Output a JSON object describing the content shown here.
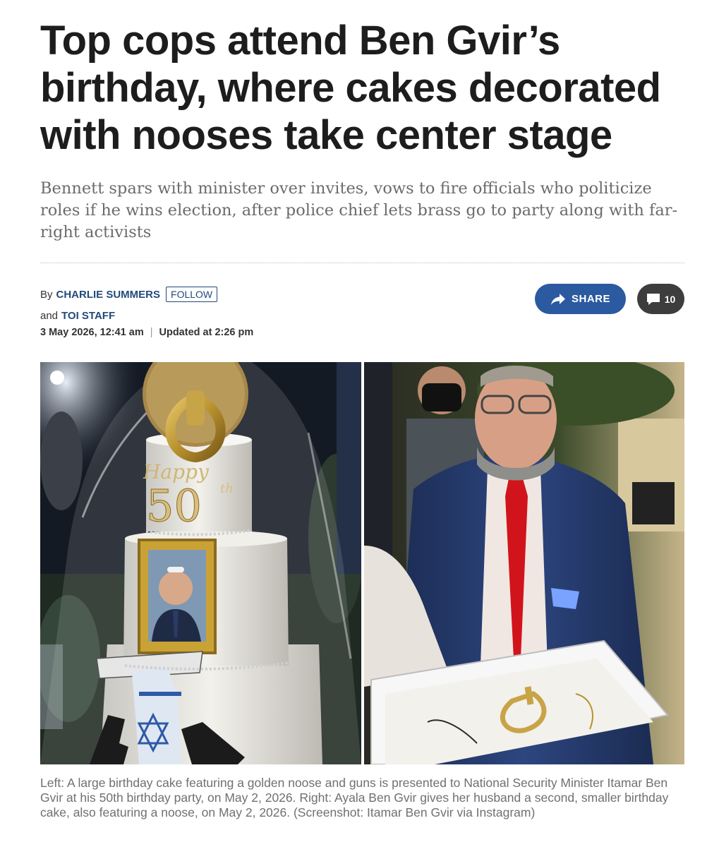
{
  "headline": "Top cops attend Ben Gvir’s birthday, where cakes decorated with nooses take center stage",
  "subheadline": "Bennett spars with minister over invites, vows to fire officials who politicize roles if he wins election, after police chief lets brass go to party along with far-right activists",
  "byline": {
    "by_label": "By",
    "author1": "CHARLIE SUMMERS",
    "follow_label": "FOLLOW",
    "and_label": "and",
    "author2": "TOI STAFF"
  },
  "dates": {
    "published": "3 May 2026, 12:41 am",
    "separator": "|",
    "updated": "Updated at 2:26 pm"
  },
  "actions": {
    "share_label": "SHARE",
    "comment_count": "10"
  },
  "photos": {
    "left_cake_text": "Happy",
    "left_cake_number": "50",
    "left_cake_suffix": "th"
  },
  "caption": "Left: A large birthday cake featuring a golden noose and guns is presented to National Security Minister Itamar Ben Gvir at his 50th birthday party, on May 2, 2026. Right: Ayala Ben Gvir gives her husband a second, smaller birthday cake, also featuring a noose, on May 2, 2026. (Screenshot: Itamar Ben Gvir via Instagram)",
  "colors": {
    "accent": "#2b5aa0",
    "author_link": "#234a7a",
    "comment_button": "#3d3d3d"
  },
  "icons": {
    "share": "share-arrow-icon",
    "comment": "comment-bubble-icon"
  }
}
